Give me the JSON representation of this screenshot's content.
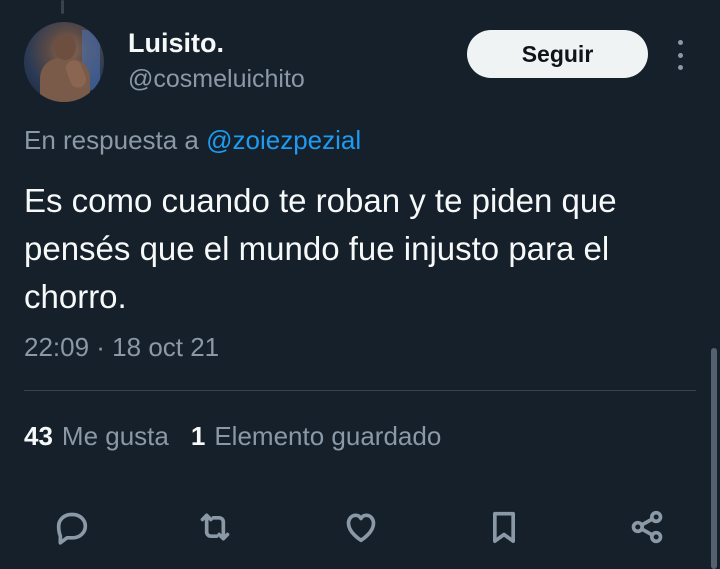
{
  "author": {
    "name": "Luisito.",
    "handle": "@cosmeluichito",
    "follow_label": "Seguir"
  },
  "reply": {
    "prefix": "En respuesta a",
    "to_handle": "@zoiezpezial"
  },
  "tweet": {
    "text": "Es como cuando te roban y te piden que pensés que el mundo fue injusto para el chorro.",
    "timestamp": "22:09 · 18 oct 21"
  },
  "stats": {
    "likes_count": "43",
    "likes_label": "Me gusta",
    "bookmarks_count": "1",
    "bookmarks_label": "Elemento guardado"
  },
  "actions": [
    {
      "icon": "reply-icon"
    },
    {
      "icon": "retweet-icon"
    },
    {
      "icon": "like-icon"
    },
    {
      "icon": "bookmark-icon"
    },
    {
      "icon": "share-icon"
    }
  ],
  "colors": {
    "background": "#15202b",
    "text": "#f7f9f9",
    "secondary": "#8b98a5",
    "link": "#1d9bf0",
    "button_bg": "#eff3f4"
  }
}
